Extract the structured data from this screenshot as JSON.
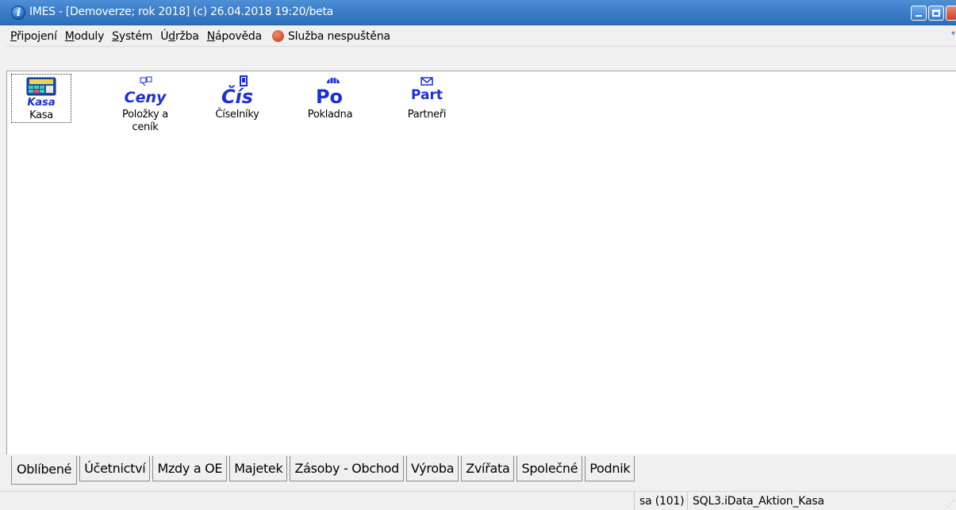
{
  "window": {
    "title": "IMES - [Demoverze;  rok 2018] (c) 26.04.2018 19:20/beta"
  },
  "menu": {
    "items": [
      {
        "first": "P",
        "rest": "řipojení"
      },
      {
        "first": "M",
        "rest": "oduly"
      },
      {
        "first": "S",
        "rest": "ystém"
      },
      {
        "first": "Ú",
        "mid": "d",
        "rest": "ržba"
      },
      {
        "first": "N",
        "rest": "ápověda"
      }
    ],
    "labels": [
      "Připojení",
      "Moduly",
      "Systém",
      "Údržba",
      "Nápověda"
    ],
    "service_status": "Služba nespuštěna",
    "service_color": "#d05a34"
  },
  "tiles": [
    {
      "icon_text": "Kasa",
      "label": "Kasa",
      "icon": "cash-register-icon"
    },
    {
      "icon_text": "Ceny",
      "label": "Položky a ceník",
      "icon": "price-icon"
    },
    {
      "icon_text": "Čís",
      "label": "Číselníky",
      "icon": "codebook-icon"
    },
    {
      "icon_text": "Po",
      "label": "Pokladna",
      "icon": "cashbox-icon"
    },
    {
      "icon_text": "Part",
      "label": "Partneři",
      "icon": "partner-icon"
    }
  ],
  "tabs": [
    "Oblíbené",
    "Účetnictví",
    "Mzdy a OE",
    "Majetek",
    "Zásoby - Obchod",
    "Výroba",
    "Zvířata",
    "Společné",
    "Podnik"
  ],
  "active_tab": "Oblíbené",
  "status": {
    "user": "sa (101)",
    "database": "SQL3.iData_Aktion_Kasa"
  },
  "colors": {
    "titlebar": "#3b7ec8",
    "icon_text": "#1b2fd6"
  }
}
